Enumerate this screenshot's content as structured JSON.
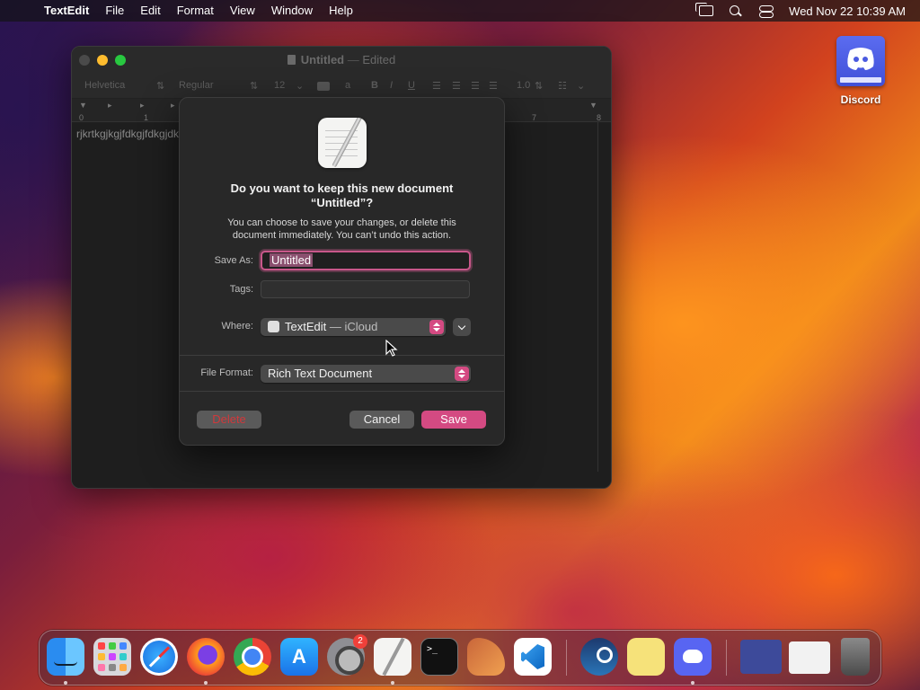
{
  "menubar": {
    "apple_glyph": "",
    "app_name": "TextEdit",
    "menus": [
      "File",
      "Edit",
      "Format",
      "View",
      "Window",
      "Help"
    ],
    "clock": "Wed Nov 22  10:39 AM"
  },
  "desktop": {
    "icons": [
      {
        "label": "Discord",
        "icon": "discord-icon"
      }
    ]
  },
  "window": {
    "title": "Untitled",
    "title_status": "Edited",
    "title_sep": "—",
    "toolbar": {
      "font_family": "Helvetica",
      "font_style": "Regular",
      "font_size": "12",
      "line_spacing": "1.0"
    },
    "ruler": [
      "0",
      "1",
      "7",
      "8"
    ],
    "body_text": "rjkrtkgjkgjfdkgjfdkgjdk"
  },
  "dialog": {
    "title_line1": "Do you want to keep this new document",
    "title_line2": "“Untitled”?",
    "message_line1": "You can choose to save your changes, or delete this",
    "message_line2": "document immediately. You can’t undo this action.",
    "save_as_label": "Save As:",
    "save_as_value": "Untitled",
    "tags_label": "Tags:",
    "where_label": "Where:",
    "where_value": "TextEdit",
    "where_location": "— iCloud",
    "file_format_label": "File Format:",
    "file_format_value": "Rich Text Document",
    "delete_label": "Delete",
    "cancel_label": "Cancel",
    "save_label": "Save"
  },
  "dock": {
    "apps": [
      "Finder",
      "Launchpad",
      "Safari",
      "Firefox",
      "Google Chrome",
      "App Store",
      "System Settings",
      "TextEdit",
      "Terminal",
      "Instruments",
      "Visual Studio Code",
      "Steam",
      "Stickies",
      "Discord"
    ],
    "settings_badge": "2"
  },
  "colors": {
    "accent": "#d44a82",
    "focus_ring": "#c8578a",
    "delete_text": "#d0383b",
    "sheet_bg": "#282828"
  }
}
